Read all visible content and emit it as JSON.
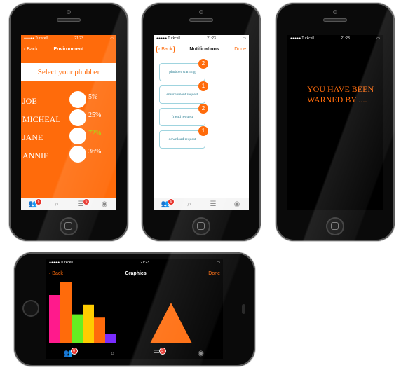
{
  "status": {
    "carrier": "●●●●● Turkcell",
    "time": "21:23"
  },
  "screen1": {
    "nav": {
      "back": "Back",
      "title": "Environment"
    },
    "select_label": "Select your phubber",
    "people": [
      {
        "name": "JOE",
        "pct": "5%",
        "pct_color": "#ffffff"
      },
      {
        "name": "MICHEAL",
        "pct": "25%",
        "pct_color": "#ffffff"
      },
      {
        "name": "JANE",
        "pct": "72%",
        "pct_color": "#9be000"
      },
      {
        "name": "ANNIE",
        "pct": "36%",
        "pct_color": "#ffffff"
      }
    ],
    "tabs": [
      {
        "icon": "people-icon",
        "badge": "6"
      },
      {
        "icon": "search-icon",
        "badge": ""
      },
      {
        "icon": "list-icon",
        "badge": "6"
      },
      {
        "icon": "profile-icon",
        "badge": ""
      }
    ]
  },
  "screen2": {
    "nav": {
      "back": "Back",
      "title": "Notifications",
      "done": "Done"
    },
    "items": [
      {
        "label": "phubber warning",
        "count": "2"
      },
      {
        "label": "environment request",
        "count": "1"
      },
      {
        "label": "friend request",
        "count": "2"
      },
      {
        "label": "download request",
        "count": "1"
      }
    ],
    "tabs": [
      {
        "icon": "people-icon",
        "badge": "6"
      },
      {
        "icon": "search-icon",
        "badge": ""
      },
      {
        "icon": "list-icon",
        "badge": ""
      },
      {
        "icon": "profile-icon",
        "badge": ""
      }
    ]
  },
  "screen3": {
    "message": "YOU HAVE BEEN WARNED BY ...."
  },
  "screen4": {
    "nav": {
      "back": "Back",
      "title": "Graphics",
      "done": "Done"
    },
    "tabs": [
      {
        "icon": "people-icon",
        "badge": "6"
      },
      {
        "icon": "search-icon",
        "badge": ""
      },
      {
        "icon": "list-icon",
        "badge": "3"
      },
      {
        "icon": "profile-icon",
        "badge": ""
      }
    ]
  },
  "chart_data": [
    {
      "type": "bar",
      "values": [
        75,
        95,
        45,
        60,
        40,
        15
      ],
      "colors": [
        "#ff1a8c",
        "#ff6b0b",
        "#66ee22",
        "#ffcc00",
        "#ff6b0b",
        "#7a2cff"
      ],
      "ylim": [
        0,
        100
      ]
    },
    {
      "type": "area",
      "shape": "triangle",
      "color": "#ff6b0b"
    }
  ],
  "colors": {
    "accent": "#ff6b0b",
    "badge": "#e8322a"
  }
}
